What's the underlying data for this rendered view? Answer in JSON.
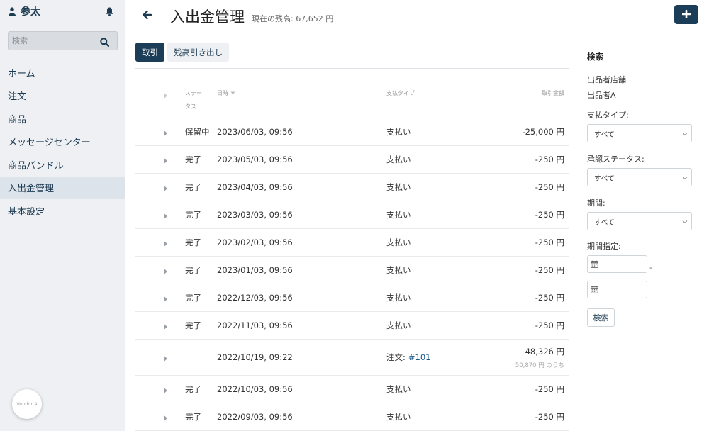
{
  "user": {
    "name": "参太"
  },
  "sidebar": {
    "search_placeholder": "検索",
    "items": [
      {
        "label": "ホーム"
      },
      {
        "label": "注文"
      },
      {
        "label": "商品"
      },
      {
        "label": "メッセージセンター"
      },
      {
        "label": "商品バンドル"
      },
      {
        "label": "入出金管理",
        "active": true
      },
      {
        "label": "基本設定"
      }
    ],
    "vendor_badge": "Vendor A"
  },
  "header": {
    "title": "入出金管理",
    "balance": "現在の残高: 67,652 円",
    "add_icon": "plus-icon"
  },
  "tabs": [
    {
      "label": "取引",
      "active": true
    },
    {
      "label": "残高引き出し",
      "active": false
    }
  ],
  "table": {
    "headers": {
      "status": "ステー\nタス",
      "date": "日時",
      "type": "支払タイプ",
      "amount": "取引金額"
    },
    "rows": [
      {
        "status": "保留中",
        "date": "2023/06/03, 09:56",
        "type": "支払い",
        "amount": "-25,000 円"
      },
      {
        "status": "完了",
        "date": "2023/05/03, 09:56",
        "type": "支払い",
        "amount": "-250 円"
      },
      {
        "status": "完了",
        "date": "2023/04/03, 09:56",
        "type": "支払い",
        "amount": "-250 円"
      },
      {
        "status": "完了",
        "date": "2023/03/03, 09:56",
        "type": "支払い",
        "amount": "-250 円"
      },
      {
        "status": "完了",
        "date": "2023/02/03, 09:56",
        "type": "支払い",
        "amount": "-250 円"
      },
      {
        "status": "完了",
        "date": "2023/01/03, 09:56",
        "type": "支払い",
        "amount": "-250 円"
      },
      {
        "status": "完了",
        "date": "2022/12/03, 09:56",
        "type": "支払い",
        "amount": "-250 円"
      },
      {
        "status": "完了",
        "date": "2022/11/03, 09:56",
        "type": "支払い",
        "amount": "-250 円"
      },
      {
        "status": "",
        "date": "2022/10/19, 09:22",
        "type": "注文:",
        "order": "#101",
        "amount": "48,326 円",
        "amount_sub": "50,870 円 のうち"
      },
      {
        "status": "完了",
        "date": "2022/10/03, 09:56",
        "type": "支払い",
        "amount": "-250 円"
      },
      {
        "status": "完了",
        "date": "2022/09/03, 09:56",
        "type": "支払い",
        "amount": "-250 円"
      }
    ]
  },
  "filters": {
    "title": "検索",
    "seller_label": "出品者店舗",
    "seller_value": "出品者A",
    "payment_type_label": "支払タイプ:",
    "payment_type_value": "すべて",
    "approval_label": "承認ステータス:",
    "approval_value": "すべて",
    "period_label": "期間:",
    "period_value": "すべて",
    "range_label": "期間指定:",
    "range_separator": "-",
    "search_button": "検索"
  }
}
